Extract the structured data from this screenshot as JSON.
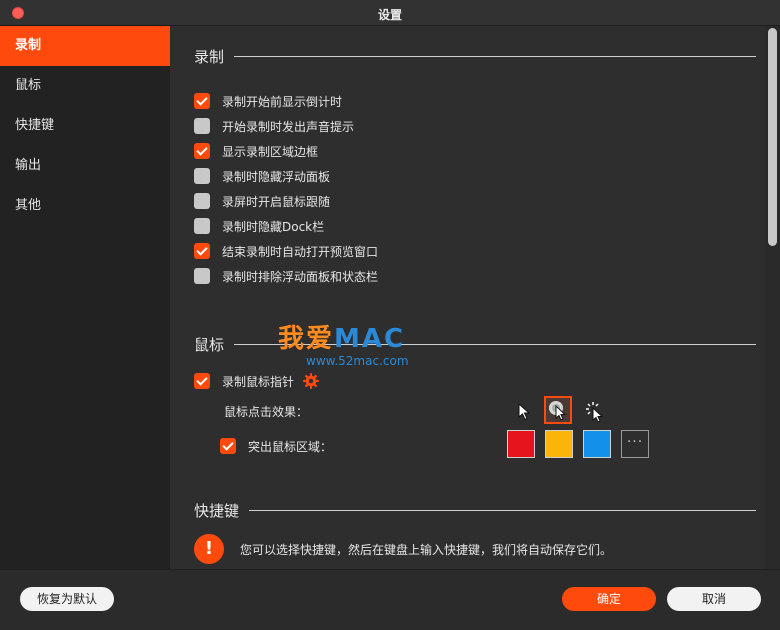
{
  "window": {
    "title": "设置"
  },
  "sidebar": {
    "items": [
      {
        "label": "录制",
        "active": true
      },
      {
        "label": "鼠标",
        "active": false
      },
      {
        "label": "快捷键",
        "active": false
      },
      {
        "label": "输出",
        "active": false
      },
      {
        "label": "其他",
        "active": false
      }
    ]
  },
  "recording": {
    "title": "录制",
    "options": [
      {
        "label": "录制开始前显示倒计时",
        "checked": true
      },
      {
        "label": "开始录制时发出声音提示",
        "checked": false
      },
      {
        "label": "显示录制区域边框",
        "checked": true
      },
      {
        "label": "录制时隐藏浮动面板",
        "checked": false
      },
      {
        "label": "录屏时开启鼠标跟随",
        "checked": false
      },
      {
        "label": "录制时隐藏Dock栏",
        "checked": false
      },
      {
        "label": "结束录制时自动打开预览窗口",
        "checked": true
      },
      {
        "label": "录制时排除浮动面板和状态栏",
        "checked": false
      }
    ]
  },
  "mouse": {
    "title": "鼠标",
    "record_pointer": {
      "label": "录制鼠标指针",
      "checked": true
    },
    "click_effect_label": "鼠标点击效果：",
    "click_effects": [
      "cursor-plain-icon",
      "cursor-ripple-icon",
      "cursor-burst-icon"
    ],
    "selected_effect": 1,
    "highlight": {
      "label": "突出鼠标区域：",
      "checked": true
    },
    "colors": [
      "#e6141c",
      "#fbb40a",
      "#1390ea"
    ],
    "more_label": "···"
  },
  "watermark": {
    "main_cn": "我爱",
    "main_en": "MAC",
    "url": "www.52mac.com"
  },
  "shortcuts": {
    "title": "快捷键",
    "info_icon": "!",
    "info_text": "您可以选择快捷键，然后在键盘上输入快捷键，我们将自动保存它们。"
  },
  "footer": {
    "reset_label": "恢复为默认",
    "ok_label": "确定",
    "cancel_label": "取消"
  },
  "accent": "#fe4a0c"
}
